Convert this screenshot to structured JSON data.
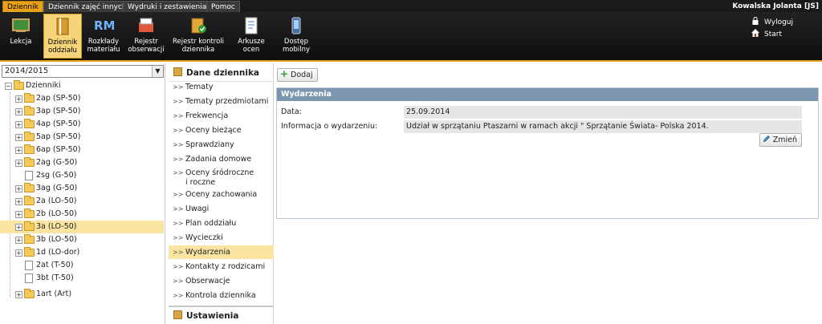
{
  "menu": {
    "tabs": [
      "Dziennik",
      "Dziennik zajęć innych",
      "Wydruki i zestawienia",
      "Pomoc"
    ],
    "user": "Kowalska Jolanta [JS]"
  },
  "toolbar": {
    "buttons": [
      {
        "label1": "Lekcja",
        "label2": ""
      },
      {
        "label1": "Dziennik",
        "label2": "oddziału"
      },
      {
        "label1": "Rozkłady",
        "label2": "materiału"
      },
      {
        "label1": "Rejestr",
        "label2": "obserwacji"
      },
      {
        "label1": "Rejestr kontroli",
        "label2": "dziennika"
      },
      {
        "label1": "Arkusze",
        "label2": "ocen"
      },
      {
        "label1": "Dostęp",
        "label2": "mobilny"
      }
    ],
    "logout": "Wyloguj",
    "start": "Start",
    "rm_text": "RM"
  },
  "left": {
    "year": "2014/2015",
    "root": "Dzienniki",
    "items": [
      "2ap (SP-50)",
      "3ap (SP-50)",
      "4ap (SP-50)",
      "5ap (SP-50)",
      "6ap (SP-50)",
      "2ag (G-50)",
      "2sg (G-50)",
      "3ag (G-50)",
      "2a (LO-50)",
      "2b (LO-50)",
      "3a (LO-50)",
      "3b (LO-50)",
      "1d (LO-dor)",
      "2at (T-50)",
      "3bt (T-50)",
      "1art (Art)"
    ]
  },
  "middle": {
    "header": "Dane dziennika",
    "items": [
      "Tematy",
      "Tematy przedmiotami",
      "Frekwencja",
      "Oceny bieżące",
      "Sprawdziany",
      "Zadania domowe",
      "Oceny śródroczne",
      "i roczne",
      "Oceny zachowania",
      "Uwagi",
      "Plan oddziału",
      "Wycieczki",
      "Wydarzenia",
      "Kontakty z rodzicami",
      "Obserwacje",
      "Kontrola dziennika"
    ],
    "footer": "Ustawienia dziennika"
  },
  "content": {
    "add_button": "Dodaj",
    "card_title": "Wydarzenia",
    "date_label": "Data:",
    "date_value": "25.09.2014",
    "info_label": "Informacja o wydarzeniu:",
    "info_value": "Udział w sprzątaniu Ptaszarni w ramach akcji \" Sprzątanie Świata- Polska 2014.",
    "edit_button": "Zmień"
  }
}
